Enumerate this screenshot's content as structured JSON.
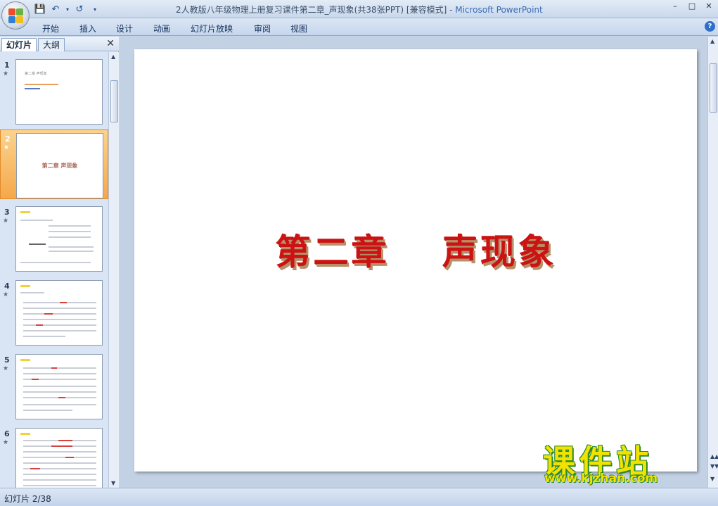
{
  "window": {
    "title": "2人教版八年级物理上册复习课件第二章_声现象(共38张PPT) [兼容模式] - ",
    "app_name": "Microsoft PowerPoint",
    "controls": [
      "–",
      "□",
      "✕"
    ]
  },
  "quick_access": {
    "save_icon": "save-icon",
    "undo_icon": "undo-icon",
    "redo_icon": "redo-icon",
    "customize_icon": "dropdown-icon"
  },
  "ribbon": {
    "tabs": [
      {
        "label": "开始"
      },
      {
        "label": "插入"
      },
      {
        "label": "设计"
      },
      {
        "label": "动画"
      },
      {
        "label": "幻灯片放映"
      },
      {
        "label": "审阅"
      },
      {
        "label": "视图"
      }
    ],
    "help": "?"
  },
  "left_pane": {
    "tabs": [
      "幻灯片",
      "大纲"
    ],
    "close": "✕",
    "thumbnails": [
      {
        "num": "1",
        "title": "第二章 声现象"
      },
      {
        "num": "2",
        "title": "第二章  声现象"
      },
      {
        "num": "3",
        "title": ""
      },
      {
        "num": "4",
        "title": ""
      },
      {
        "num": "5",
        "title": ""
      },
      {
        "num": "6",
        "title": ""
      }
    ],
    "star": "★"
  },
  "slide": {
    "title": "第二章　 声现象"
  },
  "watermark": {
    "name": "课件站",
    "url": "www.kjzhan.com"
  },
  "status": {
    "slide_position": "幻灯片 2/38"
  }
}
